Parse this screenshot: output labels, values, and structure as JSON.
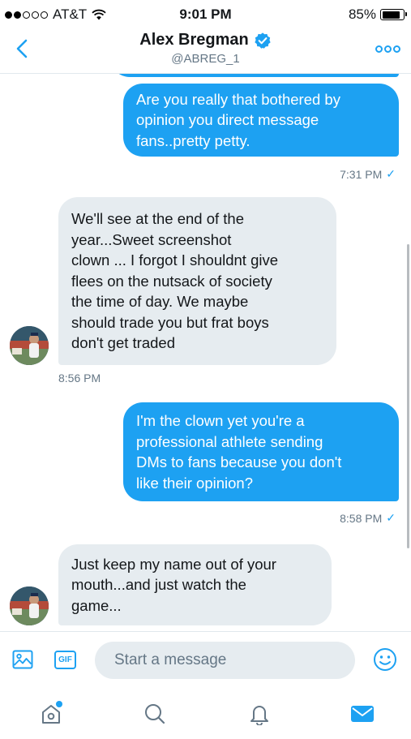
{
  "status_bar": {
    "signal_dots_filled": 2,
    "signal_dots_total": 5,
    "carrier": "AT&T",
    "time": "9:01 PM",
    "battery_text": "85%",
    "battery_level": 0.85
  },
  "header": {
    "title": "Alex Bregman",
    "handle": "@ABREG_1",
    "verified": true,
    "back_icon": "chevron-left-icon",
    "more_icon": "more-dots-icon"
  },
  "messages": [
    {
      "direction": "out",
      "lines": [
        "Are you really that bothered by",
        "opinion you direct message",
        "fans..pretty petty."
      ],
      "time": "7:31 PM",
      "read": true
    },
    {
      "direction": "in",
      "lines": [
        "We'll see at the end of the",
        "year...Sweet screenshot",
        "clown ... I forgot I shouldnt give",
        "flees on the nutsack of society",
        "the time of day. We maybe",
        "should trade you but frat boys",
        "don't get traded"
      ],
      "time": "8:56 PM"
    },
    {
      "direction": "out",
      "lines": [
        "I'm the clown yet you're a",
        "professional athlete sending",
        "DMs to fans because you don't",
        "like their opinion?"
      ],
      "time": "8:58 PM",
      "read": true
    },
    {
      "direction": "in",
      "lines": [
        "Just keep my name out of your",
        "mouth...and just watch the",
        "game..."
      ]
    }
  ],
  "composer": {
    "image_icon": "image-icon",
    "gif_label": "GIF",
    "placeholder": "Start a message",
    "emoji_icon": "emoji-icon"
  },
  "tabbar": {
    "tabs": [
      {
        "name": "home",
        "icon": "home-icon",
        "has_notification": true
      },
      {
        "name": "search",
        "icon": "search-icon"
      },
      {
        "name": "notifications",
        "icon": "bell-icon"
      },
      {
        "name": "messages",
        "icon": "envelope-icon",
        "active": true
      }
    ]
  },
  "colors": {
    "accent": "#1da1f2",
    "incoming_bubble": "#e6ecf0",
    "meta_text": "#657786"
  }
}
